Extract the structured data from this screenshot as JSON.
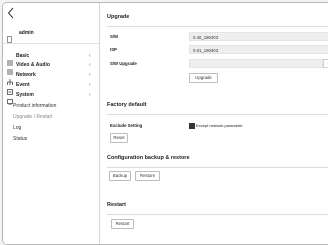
{
  "sidebar": {
    "back_icon": "chevron-left-icon",
    "user": {
      "name": "admin",
      "icon": "user-icon"
    },
    "items": [
      {
        "label": "Basic",
        "icon": "grid-icon",
        "chevron": "‹"
      },
      {
        "label": "Video & Audio",
        "icon": "list-icon",
        "chevron": "‹"
      },
      {
        "label": "Network",
        "icon": "network-icon",
        "chevron": "‹"
      },
      {
        "label": "Event",
        "icon": "bell-icon",
        "chevron": "‹"
      },
      {
        "label": "System",
        "icon": "system-icon",
        "chevron": "‹"
      }
    ],
    "system_subitems": [
      {
        "label": "Product information"
      },
      {
        "label": "Upgrade / Restart",
        "active": true
      },
      {
        "label": "Log"
      },
      {
        "label": "Status"
      }
    ]
  },
  "main": {
    "upgrade": {
      "title": "Upgrade",
      "sw_label": "S/W",
      "sw_value": "0.40_190403",
      "isp_label": "ISP",
      "isp_value": "0.01_190403",
      "sw_upgrade_label": "S/W Upgrade",
      "sw_upgrade_value": "",
      "browse_label": "...",
      "upgrade_button": "Upgrade"
    },
    "factory_default": {
      "title": "Factory default",
      "exclude_label": "Exclude Setting",
      "except_network_label": "Except network parameter",
      "except_network_checked": true,
      "reset_button": "Reset"
    },
    "config_backup": {
      "title": "Configuration backup & restore",
      "backup_button": "Backup",
      "restore_button": "Restore"
    },
    "restart": {
      "title": "Restart",
      "restart_button": "Restart"
    }
  }
}
